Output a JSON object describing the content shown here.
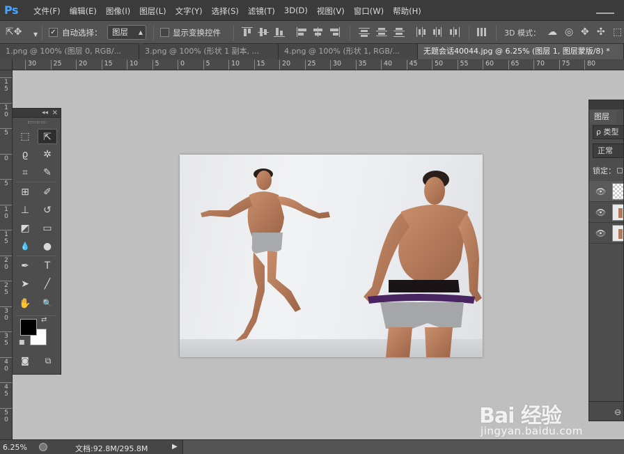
{
  "app": {
    "logo": "Ps"
  },
  "menu": [
    "文件(F)",
    "编辑(E)",
    "图像(I)",
    "图层(L)",
    "文字(Y)",
    "选择(S)",
    "滤镜(T)",
    "3D(D)",
    "视图(V)",
    "窗口(W)",
    "帮助(H)"
  ],
  "options": {
    "auto_select_label": "自动选择：",
    "auto_select_checked": true,
    "auto_select_target": "图层",
    "show_transform_label": "显示变换控件",
    "show_transform_checked": false,
    "mode_3d_label": "3D 模式："
  },
  "tabs": [
    {
      "label": "1.png @ 100% (图层 0, RGB/...",
      "active": false
    },
    {
      "label": "3.png @ 100% (形状 1 副本, ...",
      "active": false
    },
    {
      "label": "4.png @ 100% (形状 1, RGB/...",
      "active": false
    },
    {
      "label": "无题会话40044.jpg @ 6.25% (图层 1, 图层蒙版/8) *",
      "active": true
    }
  ],
  "ruler_top_labels": [
    "30",
    "25",
    "20",
    "15",
    "10",
    "5",
    "0",
    "5",
    "10",
    "15",
    "20",
    "25",
    "30",
    "35",
    "40",
    "45",
    "50",
    "55",
    "60",
    "65",
    "70",
    "75",
    "80"
  ],
  "ruler_left_labels": [
    "15",
    "10",
    "5",
    "0",
    "5",
    "10",
    "15",
    "20",
    "25",
    "30",
    "35",
    "40",
    "45",
    "50"
  ],
  "tools": [
    "marquee-tool",
    "move-tool",
    "lasso-tool",
    "magic-wand-tool",
    "crop-tool",
    "eyedropper-tool",
    "healing-brush-tool",
    "brush-tool",
    "clone-stamp-tool",
    "history-brush-tool",
    "eraser-tool",
    "gradient-tool",
    "blur-tool",
    "dodge-tool",
    "pen-tool",
    "type-tool",
    "path-selection-tool",
    "line-tool",
    "hand-tool",
    "zoom-tool"
  ],
  "tool_glyphs": {
    "type-tool": "T"
  },
  "colors": {
    "foreground": "#000000",
    "background": "#ffffff",
    "accent": "#4aa3ff"
  },
  "layers_panel": {
    "tab": "图层",
    "search": "ρ 类型",
    "blend_mode": "正常",
    "lock_label": "锁定："
  },
  "status": {
    "zoom": "6.25%",
    "doc_size": "文档:92.8M/295.8M"
  },
  "watermark": {
    "brand": "Bai 经验",
    "url": "jingyan.baidu.com"
  }
}
